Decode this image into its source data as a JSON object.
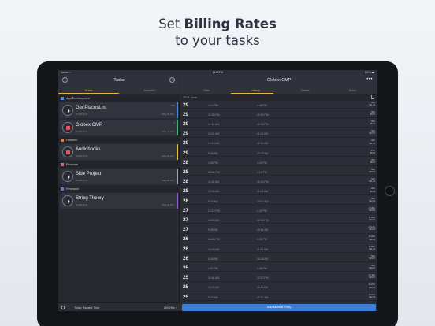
{
  "headline": {
    "line1_prefix": "Set ",
    "line1_bold": "Billing Rates",
    "line2": "to your tasks"
  },
  "status": {
    "carrier": "Carrier ⌔",
    "time": "11:20 PM",
    "battery": "100% ▬"
  },
  "left": {
    "title": "Tasks",
    "left_icon": "↓",
    "right_icon": "+",
    "segments": [
      "Active",
      "Archived"
    ],
    "sections": [
      {
        "label": "App Development",
        "color": "#4a90e2"
      },
      {
        "label": "Hobbies",
        "color": "#e8793a"
      },
      {
        "label": "Personal",
        "color": "#d96b7d"
      },
      {
        "label": "Research",
        "color": "#8e5fd6"
      }
    ],
    "tasks": [
      {
        "name": "GeoPlacesLmt",
        "sub": "$1,000 00:12",
        "time": "Today 0h 00m",
        "mini": "12h",
        "state": "play",
        "color": "#4a90e2"
      },
      {
        "name": "Globex CMP",
        "sub": "$1,000 00:12",
        "time": "Today 1h 20m",
        "mini": "1",
        "state": "stop",
        "color": "#3bb372"
      },
      {
        "name": "Audiobooks",
        "sub": "$1,000 00:12",
        "time": "Today 2h 10m",
        "mini": "",
        "state": "stop",
        "color": "#e8c53a"
      },
      {
        "name": "Side Project",
        "sub": "$1,000 00:12",
        "time": "Today 0h 05m",
        "mini": "",
        "state": "play",
        "color": "#9aa0ab"
      },
      {
        "name": "String Theory",
        "sub": "$1,000 00:12",
        "time": "Today 1h 50m",
        "mini": "",
        "state": "play",
        "color": "#8e5fd6"
      }
    ],
    "footer": {
      "label": "Today Tracked Time",
      "value": "10h 25m ›"
    }
  },
  "right": {
    "title": "Globex CMP",
    "menu": "•••",
    "segments": [
      "Stats",
      "History",
      "Details",
      "Notes"
    ],
    "date_header": "2018, June",
    "rows": [
      {
        "d": "29",
        "s": "1:14 PM",
        "e": "1:48 PM",
        "a1": "34m",
        "a2": "$11.33"
      },
      {
        "d": "29",
        "s": "12:30 PM",
        "e": "12:59 PM",
        "a1": "29m",
        "a2": "$9.67"
      },
      {
        "d": "29",
        "s": "11:40 AM",
        "e": "12:05 PM",
        "a1": "25m",
        "a2": "$8.33"
      },
      {
        "d": "29",
        "s": "11:02 AM",
        "e": "11:34 AM",
        "a1": "32m",
        "a2": "$10.67"
      },
      {
        "d": "29",
        "s": "10:18 AM",
        "e": "10:52 AM",
        "a1": "34m",
        "a2": "$11.33"
      },
      {
        "d": "29",
        "s": "9:36 AM",
        "e": "10:03 AM",
        "a1": "27m",
        "a2": "$9.00"
      },
      {
        "d": "28",
        "s": "1:58 PM",
        "e": "2:24 PM",
        "a1": "26m",
        "a2": "$8.67"
      },
      {
        "d": "28",
        "s": "12:44 PM",
        "e": "1:16 PM",
        "a1": "32m",
        "a2": "$10.67"
      },
      {
        "d": "28",
        "s": "11:30 AM",
        "e": "12:04 PM",
        "a1": "34m",
        "a2": "$11.33"
      },
      {
        "d": "28",
        "s": "10:36 AM",
        "e": "11:04 AM",
        "a1": "28m",
        "a2": "$9.33"
      },
      {
        "d": "28",
        "s": "9:34 AM",
        "e": "10:10 AM",
        "a1": "36m",
        "a2": "$12.00"
      },
      {
        "d": "27",
        "s": "12:12 PM",
        "e": "1:21 PM",
        "a1": "1h 09m",
        "a2": "$23.00"
      },
      {
        "d": "27",
        "s": "10:53 AM",
        "e": "12:02 PM",
        "a1": "1h 09m",
        "a2": "$23.00"
      },
      {
        "d": "27",
        "s": "9:38 AM",
        "e": "10:51 AM",
        "a1": "1h 13m",
        "a2": "$24.33"
      },
      {
        "d": "26",
        "s": "12:24 PM",
        "e": "1:30 PM",
        "a1": "1h 06m",
        "a2": "$22.00"
      },
      {
        "d": "26",
        "s": "10:49 AM",
        "e": "11:53 AM",
        "a1": "1h 04m",
        "a2": "$21.33"
      },
      {
        "d": "26",
        "s": "9:36 AM",
        "e": "10:26 AM",
        "a1": "50m",
        "a2": "$16.67"
      },
      {
        "d": "25",
        "s": "1:07 PM",
        "e": "2:06 PM",
        "a1": "59m",
        "a2": "$19.67"
      },
      {
        "d": "25",
        "s": "11:46 AM",
        "e": "12:57 PM",
        "a1": "1h 11m",
        "a2": "$23.67"
      },
      {
        "d": "25",
        "s": "10:35 AM",
        "e": "11:42 AM",
        "a1": "1h 07m",
        "a2": "$22.33"
      },
      {
        "d": "25",
        "s": "9:24 AM",
        "e": "10:31 AM",
        "a1": "1h 07m",
        "a2": "$22.33"
      }
    ],
    "add_button": "Add Manual Entry"
  }
}
